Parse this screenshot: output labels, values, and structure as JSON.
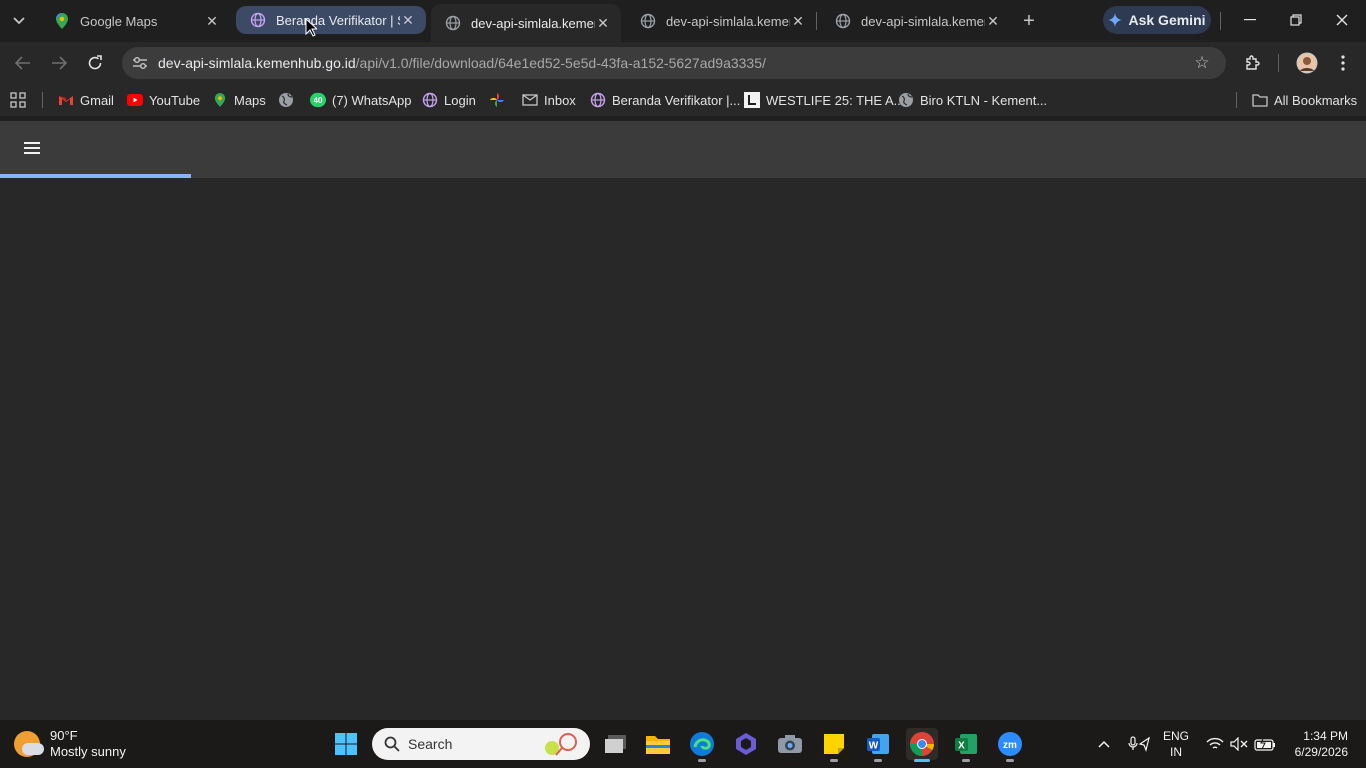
{
  "tabs": [
    {
      "title": "Google Maps",
      "favicon": "maps-pin-icon",
      "state": "normal"
    },
    {
      "title": "Beranda Verifikator | Simlala",
      "favicon": "globe-icon",
      "state": "hover"
    },
    {
      "title": "dev-api-simlala.kemenhub.go.id",
      "favicon": "globe-icon",
      "state": "active"
    },
    {
      "title": "dev-api-simlala.kemenhub.go.id",
      "favicon": "globe-icon",
      "state": "normal"
    },
    {
      "title": "dev-api-simlala.kemenhub.go.id",
      "favicon": "globe-icon",
      "state": "normal"
    }
  ],
  "gemini": {
    "label": "Ask Gemini"
  },
  "omnibox": {
    "host": "dev-api-simlala.kemenhub.go.id",
    "path": "/api/v1.0/file/download/64e1ed52-5e5d-43fa-a152-5627ad9a3335/"
  },
  "bookmarks": [
    {
      "label": "Gmail",
      "icon": "gmail-icon"
    },
    {
      "label": "YouTube",
      "icon": "youtube-icon"
    },
    {
      "label": "Maps",
      "icon": "maps-pin-icon"
    },
    {
      "label": "",
      "icon": "globe-icon"
    },
    {
      "label": "(7) WhatsApp",
      "icon": "whatsapp-icon",
      "badge": "40"
    },
    {
      "label": "Login",
      "icon": "globe-icon"
    },
    {
      "label": "",
      "icon": "pinwheel-icon"
    },
    {
      "label": "Inbox",
      "icon": "mail-icon"
    },
    {
      "label": "Beranda Verifikator |...",
      "icon": "globe-icon"
    },
    {
      "label": "WESTLIFE 25: THE A...",
      "icon": "letterboxd-icon"
    },
    {
      "label": "Biro KTLN - Kement...",
      "icon": "globe-icon"
    }
  ],
  "all_bookmarks": {
    "label": "All Bookmarks"
  },
  "page": {
    "loading_progress": 0.14
  },
  "taskbar": {
    "weather_temp": "90°F",
    "weather_desc": "Mostly sunny",
    "search_placeholder": "Search",
    "lang_line1": "ENG",
    "lang_line2": "IN",
    "time": "1:34 PM",
    "date": "6/29/2026"
  },
  "colors": {
    "accent": "#8ab4f8",
    "header": "#3b3b3b",
    "background": "#282828"
  }
}
